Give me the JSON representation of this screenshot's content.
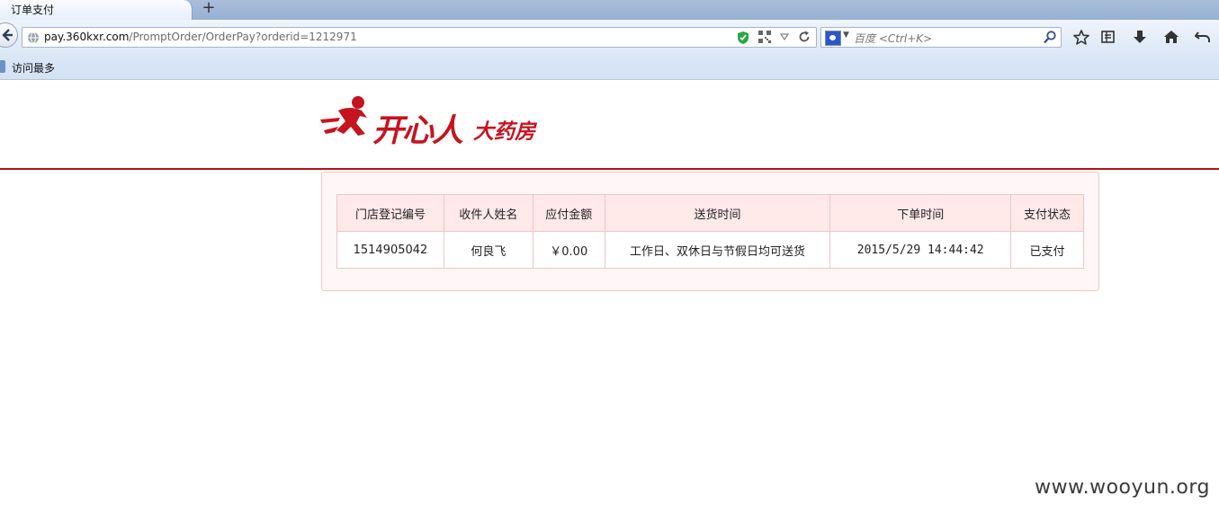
{
  "browser": {
    "tab_title": "订单支付",
    "new_tab": "+",
    "url_host": "pay.360kxr.com",
    "url_path": "/PromptOrder/OrderPay?orderid=1212971",
    "search_placeholder": "百度 <Ctrl+K>",
    "bookmark_label": "访问最多"
  },
  "logo": {
    "name": "开心人",
    "sub": "大药房",
    "color": "#c6141f"
  },
  "table": {
    "headers": [
      "门店登记编号",
      "收件人姓名",
      "应付金额",
      "送货时间",
      "下单时间",
      "支付状态"
    ],
    "row": {
      "store_id": "1514905042",
      "recipient": "何良飞",
      "amount": "￥0.00",
      "delivery_time": "工作日、双休日与节假日均可送货",
      "order_time": "2015/5/29 14:44:42",
      "status": "已支付"
    }
  },
  "watermark": "www.wooyun.org",
  "colors": {
    "accent": "#b3121c",
    "header_bg": "#ffe9e9",
    "border": "#f1c4c6"
  }
}
